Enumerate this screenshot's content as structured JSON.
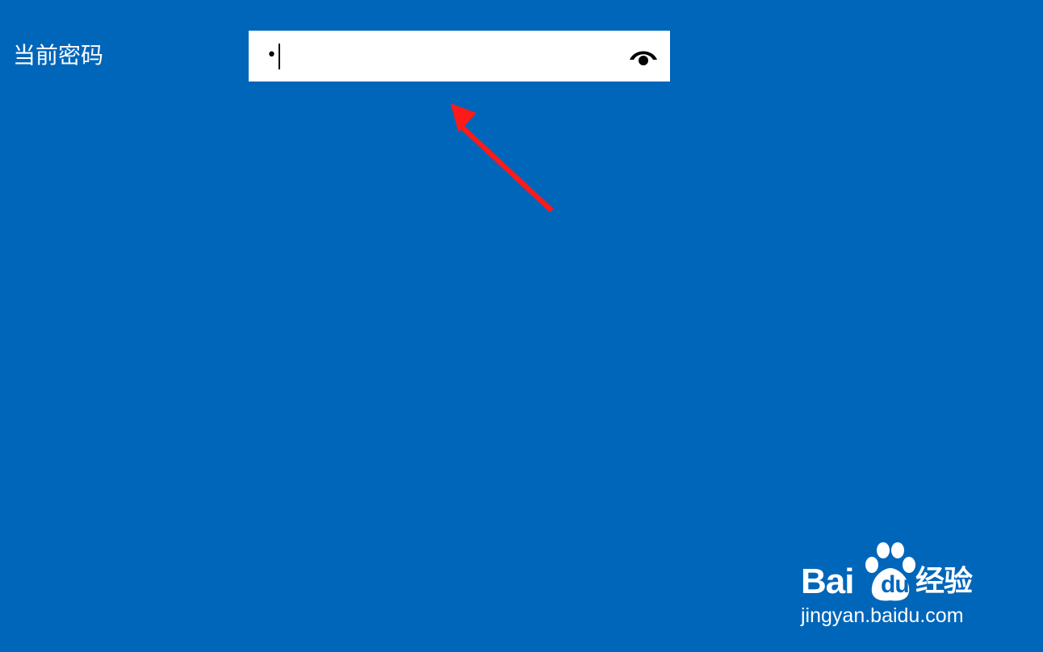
{
  "form": {
    "current_password_label": "当前密码",
    "password_masked_value": "•"
  },
  "icons": {
    "reveal": "eye-icon",
    "annotation": "red-arrow-icon"
  },
  "watermark": {
    "brand_bai": "Bai",
    "brand_du": "du",
    "brand_cn": "经验",
    "url": "jingyan.baidu.com"
  },
  "colors": {
    "background": "#0066ba",
    "field": "#ffffff",
    "arrow": "#ff1a1a"
  }
}
